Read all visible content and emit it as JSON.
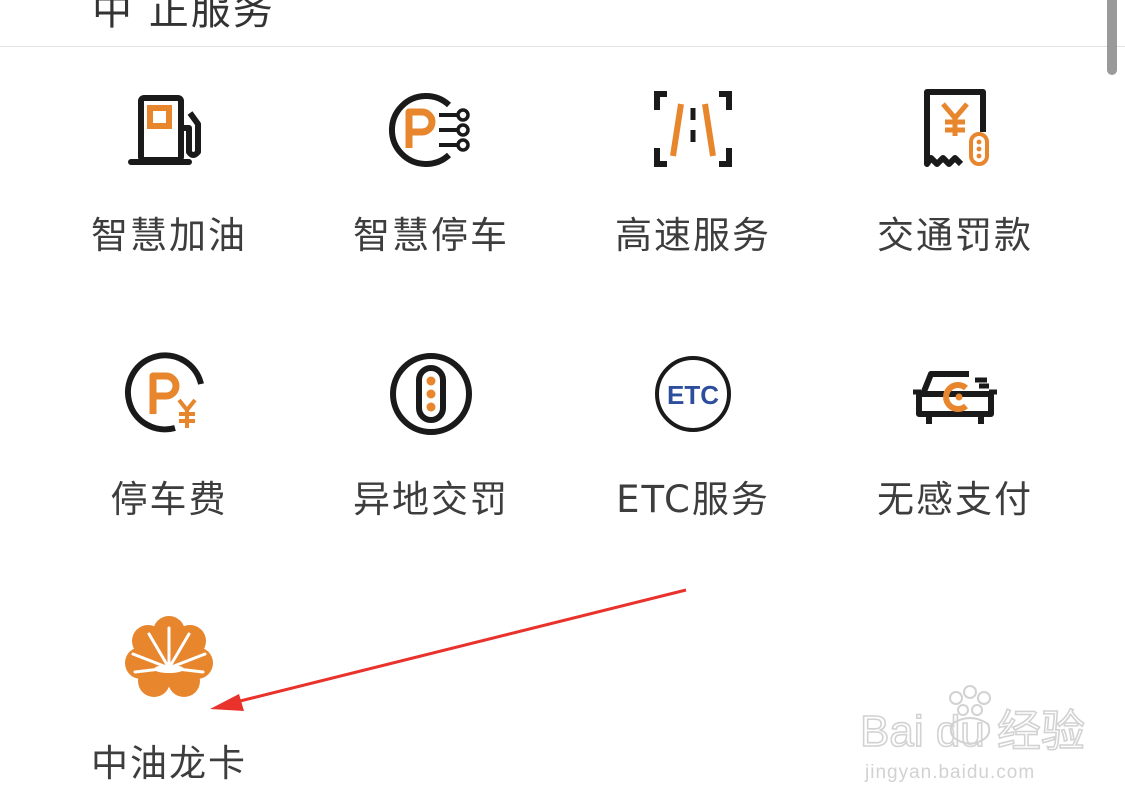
{
  "section_title_clipped": "中 正服务",
  "services": [
    {
      "label": "智慧加油",
      "icon": "fuel-pump-icon"
    },
    {
      "label": "智慧停车",
      "icon": "smart-parking-icon"
    },
    {
      "label": "高速服务",
      "icon": "highway-icon"
    },
    {
      "label": "交通罚款",
      "icon": "traffic-fine-receipt-icon"
    },
    {
      "label": "停车费",
      "icon": "parking-fee-icon"
    },
    {
      "label": "异地交罚",
      "icon": "traffic-light-icon"
    },
    {
      "label": "ETC服务",
      "icon": "etc-icon"
    },
    {
      "label": "无感支付",
      "icon": "car-pay-icon"
    },
    {
      "label": "中油龙卡",
      "icon": "petrochina-logo-icon"
    }
  ],
  "etc_icon_text": "ETC",
  "watermark": {
    "brand": "Bai du 经验",
    "url": "jingyan.baidu.com"
  },
  "colors": {
    "accent": "#e8862e",
    "icon_stroke": "#1a1a1a",
    "etc_blue": "#2d4e9c",
    "annotation_arrow": "#e8322b"
  }
}
